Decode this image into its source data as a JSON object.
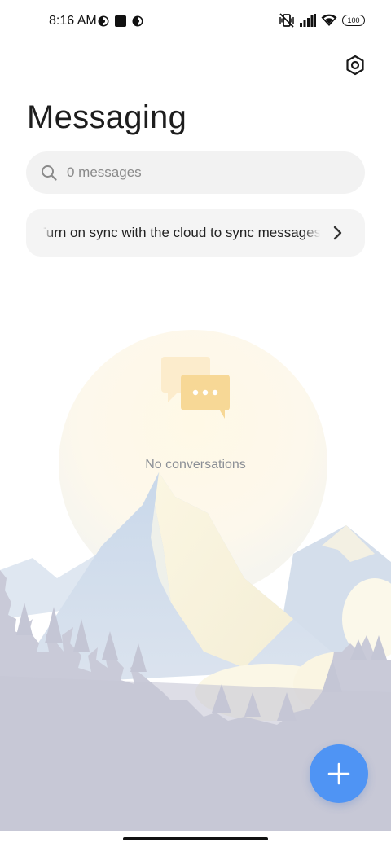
{
  "status_bar": {
    "time": "8:16 AM",
    "battery": "100"
  },
  "header": {
    "title": "Messaging",
    "settings_icon": "settings-hexagon-icon"
  },
  "search": {
    "placeholder": "0 messages"
  },
  "sync_banner": {
    "text": "Turn on sync with the cloud to sync messages"
  },
  "empty_state": {
    "text": "No conversations"
  },
  "fab": {
    "icon": "plus-icon",
    "color": "#4f94f4"
  },
  "colors": {
    "accent": "#4f94f4",
    "illustration_gold": "#f5c76a"
  }
}
